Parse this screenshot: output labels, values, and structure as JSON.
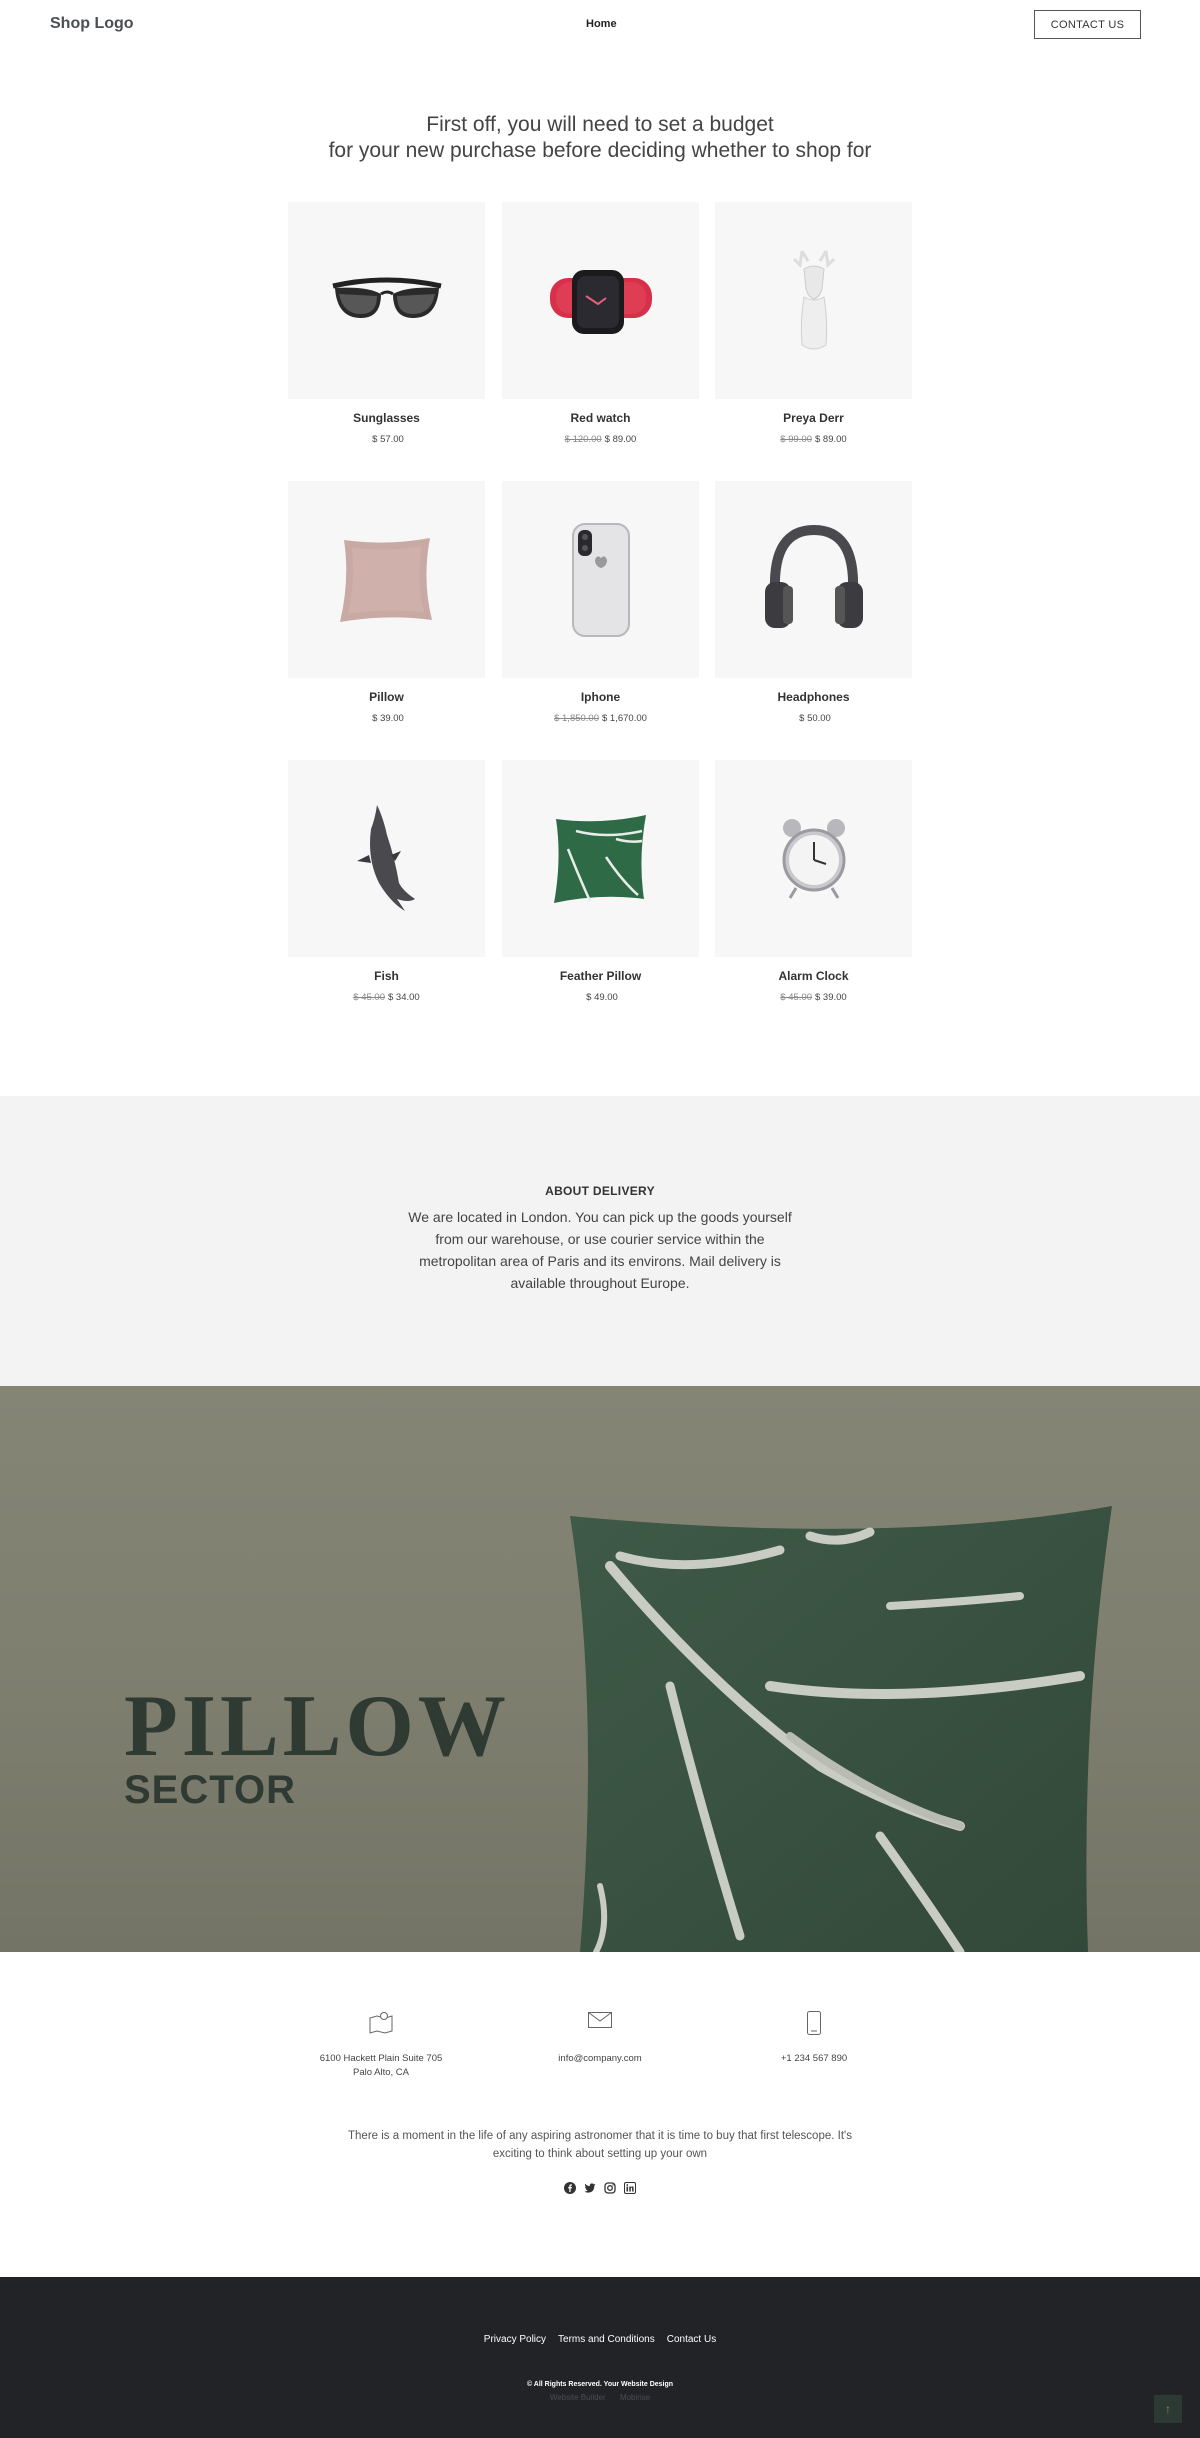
{
  "header": {
    "logo": "Shop Logo",
    "nav_home": "Home",
    "contact_button": "CONTACT US"
  },
  "intro": {
    "line1": "First off, you will need to set a budget",
    "line2": "for your new purchase before deciding whether to shop for"
  },
  "products": [
    {
      "name": "Sunglasses",
      "old_price": "",
      "price": "$ 57.00",
      "icon": "sunglasses-icon"
    },
    {
      "name": "Red watch",
      "old_price": "$ 120.00",
      "price": "$ 89.00",
      "icon": "watch-icon"
    },
    {
      "name": "Preya Derr",
      "old_price": "$ 99.00",
      "price": "$ 89.00",
      "icon": "deer-figurine-icon"
    },
    {
      "name": "Pillow",
      "old_price": "",
      "price": "$ 39.00",
      "icon": "pillow-icon"
    },
    {
      "name": "Iphone",
      "old_price": "$ 1,850.00",
      "price": "$ 1,670.00",
      "icon": "phone-icon"
    },
    {
      "name": "Headphones",
      "old_price": "",
      "price": "$ 50.00",
      "icon": "headphones-icon"
    },
    {
      "name": "Fish",
      "old_price": "$ 45.00",
      "price": "$ 34.00",
      "icon": "fish-figurine-icon"
    },
    {
      "name": "Feather Pillow",
      "old_price": "",
      "price": "$ 49.00",
      "icon": "leaf-pillow-icon"
    },
    {
      "name": "Alarm Clock",
      "old_price": "$ 45.00",
      "price": "$ 39.00",
      "icon": "alarm-clock-icon"
    }
  ],
  "delivery": {
    "title": "ABOUT DELIVERY",
    "text": "We are located in London. You can pick up the goods yourself from our warehouse, or use courier service within the metropolitan area of Paris and its environs. Mail delivery is available throughout Europe."
  },
  "banner": {
    "title": "PILLOW",
    "subtitle": "SECTOR"
  },
  "contact": {
    "address_line1": "6100 Hackett Plain Suite 705",
    "address_line2": "Palo Alto, CA",
    "email": "info@company.com",
    "phone": "+1 234 567 890",
    "blurb": "There is a moment in the life of any aspiring astronomer that it is time to buy that first telescope. It's exciting to think about setting up your own"
  },
  "social": [
    "facebook-icon",
    "twitter-icon",
    "instagram-icon",
    "linkedin-icon"
  ],
  "footer": {
    "links": [
      "Privacy Policy",
      "Terms and Conditions",
      "Contact Us"
    ],
    "copyright": "© All Rights Reserved. Your Website Design",
    "builder": "Website Builder",
    "maker": "Mobirise"
  },
  "colors": {
    "footer_bg": "#212327",
    "banner_bg": "#808071",
    "pillow_green": "#3b5443",
    "thumb_bg": "#f7f7f7"
  }
}
